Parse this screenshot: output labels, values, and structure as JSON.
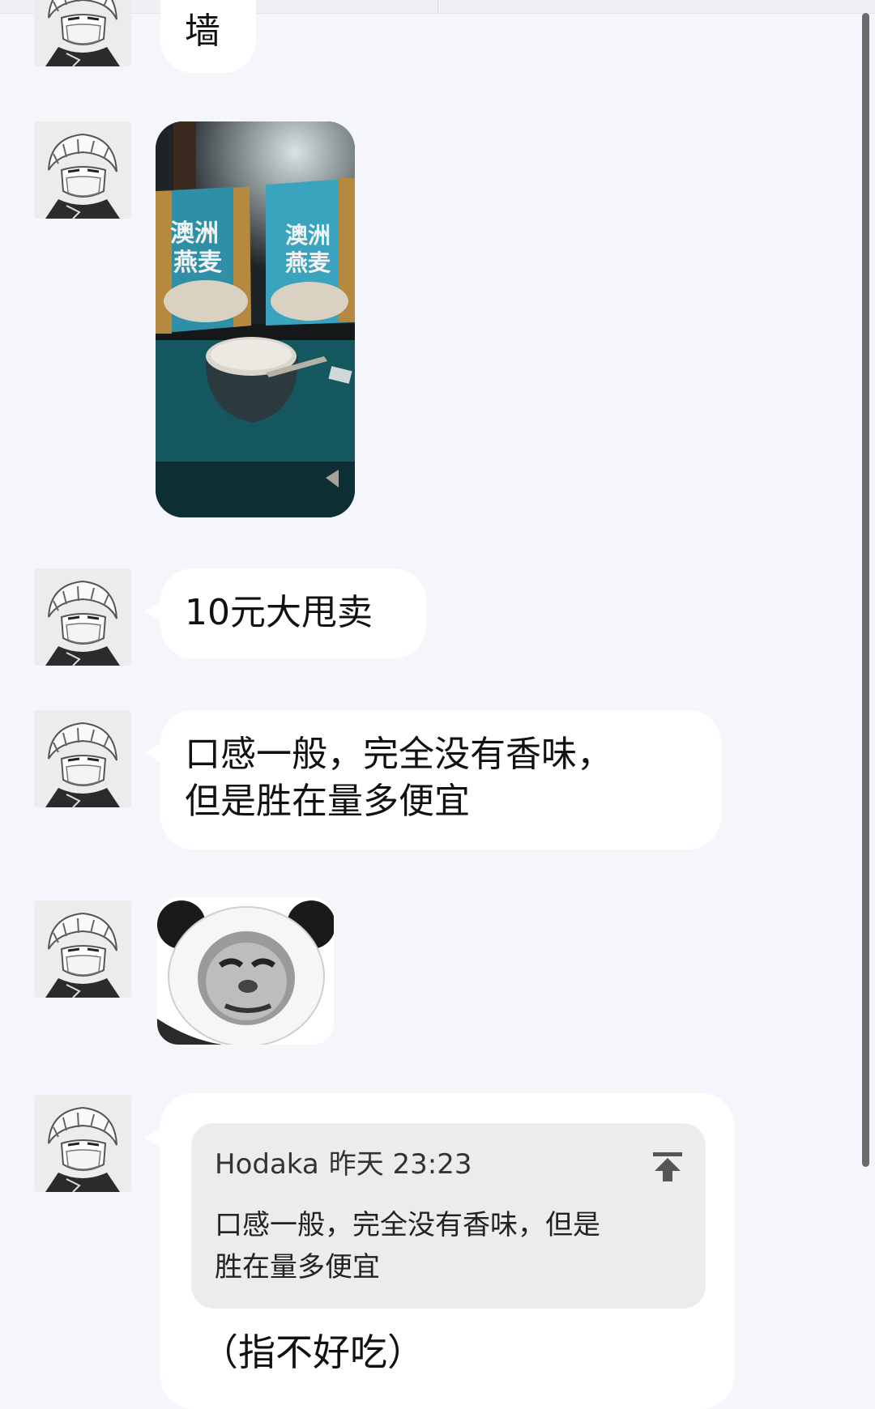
{
  "messages": [
    {
      "type": "text",
      "text": "墙"
    },
    {
      "type": "image",
      "image_caption": "澳洲燕麦"
    },
    {
      "type": "text",
      "text": "10元大甩卖"
    },
    {
      "type": "text",
      "lines": [
        "口感一般，完全没有香味，",
        "但是胜在量多便宜"
      ]
    },
    {
      "type": "sticker",
      "sticker": "panda-face"
    },
    {
      "type": "reply",
      "quote": {
        "sender": "Hodaka",
        "time": "昨天 23:23",
        "lines": [
          "口感一般，完全没有香味，但是",
          "胜在量多便宜"
        ],
        "icon": "jump-to-top-icon"
      },
      "text": "（指不好吃）"
    }
  ],
  "colors": {
    "background": "#f4f6fb",
    "bubble": "#ffffff",
    "quote_box": "#ececee",
    "scrollbar": "#6b6b6b",
    "package_teal": "#2f8fa6"
  }
}
